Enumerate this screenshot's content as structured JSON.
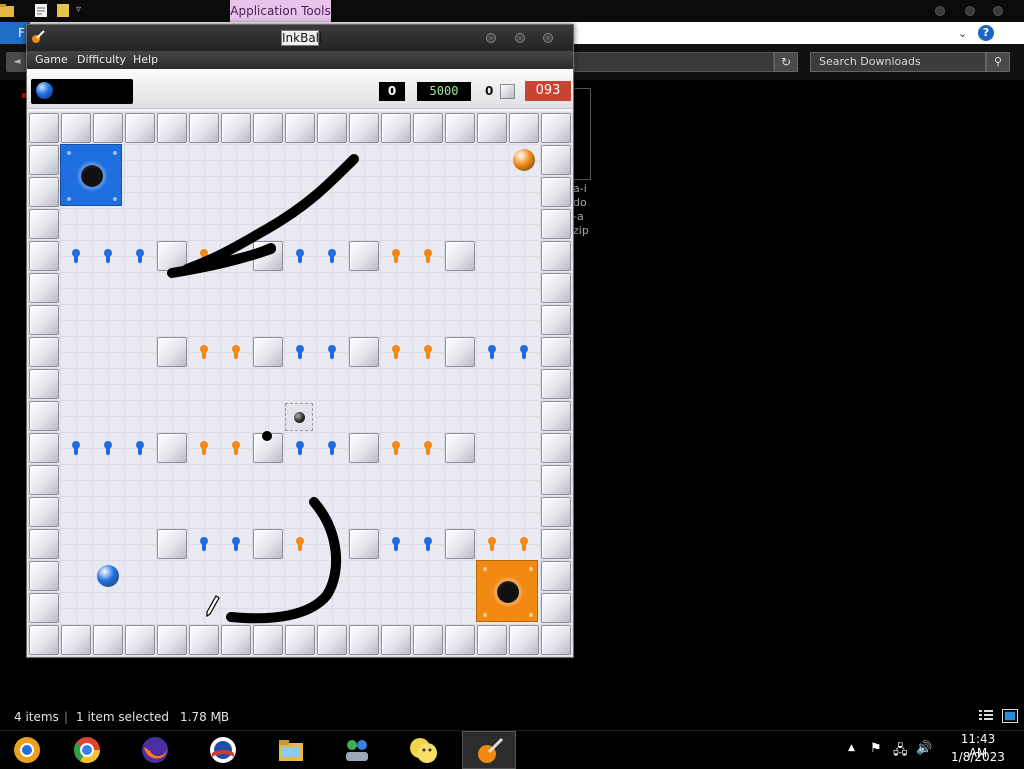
{
  "explorer": {
    "context_tab": "Application Tools",
    "file_tab": "F",
    "search_placeholder": "Search Downloads",
    "back_glyph": "◄",
    "refresh_glyph": "↻",
    "search_glyph": "⚲",
    "help_glyph": "?",
    "chevron_glyph": "⌄",
    "file_label": "a-i\ndo\n-a\nzip",
    "status": {
      "items": "4 items",
      "separator": "|",
      "selected": "1 item selected",
      "size": "1.78 MB"
    }
  },
  "inkball": {
    "title": "InkBall",
    "menu": [
      "Game",
      "Difficulty",
      "Help"
    ],
    "score": {
      "ball_count": "0",
      "points": "5000",
      "balls_missed": "0",
      "timer": "093"
    },
    "colors": {
      "blue": "#1f6ee0",
      "orange": "#f28a12",
      "timer_bg": "#c84331",
      "points_text": "#9ee79e"
    },
    "board": {
      "note": "17x17 grid of cells; walls, holes, keyholes, balls and ink strokes",
      "walls": [
        [
          0,
          0
        ],
        [
          1,
          0
        ],
        [
          2,
          0
        ],
        [
          3,
          0
        ],
        [
          4,
          0
        ],
        [
          5,
          0
        ],
        [
          6,
          0
        ],
        [
          7,
          0
        ],
        [
          8,
          0
        ],
        [
          9,
          0
        ],
        [
          10,
          0
        ],
        [
          11,
          0
        ],
        [
          12,
          0
        ],
        [
          13,
          0
        ],
        [
          14,
          0
        ],
        [
          15,
          0
        ],
        [
          16,
          0
        ],
        [
          0,
          16
        ],
        [
          1,
          16
        ],
        [
          2,
          16
        ],
        [
          3,
          16
        ],
        [
          4,
          16
        ],
        [
          5,
          16
        ],
        [
          6,
          16
        ],
        [
          7,
          16
        ],
        [
          8,
          16
        ],
        [
          9,
          16
        ],
        [
          10,
          16
        ],
        [
          11,
          16
        ],
        [
          12,
          16
        ],
        [
          13,
          16
        ],
        [
          14,
          16
        ],
        [
          15,
          16
        ],
        [
          16,
          16
        ],
        [
          0,
          1
        ],
        [
          0,
          2
        ],
        [
          0,
          3
        ],
        [
          0,
          4
        ],
        [
          0,
          5
        ],
        [
          0,
          6
        ],
        [
          0,
          7
        ],
        [
          0,
          8
        ],
        [
          0,
          9
        ],
        [
          0,
          10
        ],
        [
          0,
          11
        ],
        [
          0,
          12
        ],
        [
          0,
          13
        ],
        [
          0,
          14
        ],
        [
          0,
          15
        ],
        [
          16,
          1
        ],
        [
          16,
          2
        ],
        [
          16,
          3
        ],
        [
          16,
          4
        ],
        [
          16,
          5
        ],
        [
          16,
          6
        ],
        [
          16,
          7
        ],
        [
          16,
          8
        ],
        [
          16,
          9
        ],
        [
          16,
          10
        ],
        [
          16,
          11
        ],
        [
          16,
          12
        ],
        [
          16,
          13
        ],
        [
          16,
          14
        ],
        [
          16,
          15
        ],
        [
          4,
          4
        ],
        [
          7,
          4
        ],
        [
          10,
          4
        ],
        [
          13,
          4
        ],
        [
          4,
          7
        ],
        [
          7,
          7
        ],
        [
          10,
          7
        ],
        [
          13,
          7
        ],
        [
          4,
          10
        ],
        [
          7,
          10
        ],
        [
          10,
          10
        ],
        [
          13,
          10
        ],
        [
          4,
          13
        ],
        [
          7,
          13
        ],
        [
          10,
          13
        ],
        [
          13,
          13
        ]
      ],
      "keyholes": [
        {
          "c": 1,
          "r": 4,
          "color": "blue"
        },
        {
          "c": 2,
          "r": 4,
          "color": "blue"
        },
        {
          "c": 3,
          "r": 4,
          "color": "blue"
        },
        {
          "c": 5,
          "r": 4,
          "color": "orange"
        },
        {
          "c": 8,
          "r": 4,
          "color": "blue"
        },
        {
          "c": 9,
          "r": 4,
          "color": "blue"
        },
        {
          "c": 11,
          "r": 4,
          "color": "orange"
        },
        {
          "c": 12,
          "r": 4,
          "color": "orange"
        },
        {
          "c": 5,
          "r": 7,
          "color": "orange"
        },
        {
          "c": 6,
          "r": 7,
          "color": "orange"
        },
        {
          "c": 8,
          "r": 7,
          "color": "blue"
        },
        {
          "c": 9,
          "r": 7,
          "color": "blue"
        },
        {
          "c": 11,
          "r": 7,
          "color": "orange"
        },
        {
          "c": 12,
          "r": 7,
          "color": "orange"
        },
        {
          "c": 14,
          "r": 7,
          "color": "blue"
        },
        {
          "c": 15,
          "r": 7,
          "color": "blue"
        },
        {
          "c": 1,
          "r": 10,
          "color": "blue"
        },
        {
          "c": 2,
          "r": 10,
          "color": "blue"
        },
        {
          "c": 3,
          "r": 10,
          "color": "blue"
        },
        {
          "c": 5,
          "r": 10,
          "color": "orange"
        },
        {
          "c": 6,
          "r": 10,
          "color": "orange"
        },
        {
          "c": 8,
          "r": 10,
          "color": "blue"
        },
        {
          "c": 9,
          "r": 10,
          "color": "blue"
        },
        {
          "c": 11,
          "r": 10,
          "color": "orange"
        },
        {
          "c": 12,
          "r": 10,
          "color": "orange"
        },
        {
          "c": 5,
          "r": 13,
          "color": "blue"
        },
        {
          "c": 6,
          "r": 13,
          "color": "blue"
        },
        {
          "c": 8,
          "r": 13,
          "color": "orange"
        },
        {
          "c": 11,
          "r": 13,
          "color": "blue"
        },
        {
          "c": 12,
          "r": 13,
          "color": "blue"
        },
        {
          "c": 14,
          "r": 13,
          "color": "orange"
        },
        {
          "c": 15,
          "r": 13,
          "color": "orange"
        }
      ],
      "holes": [
        {
          "c": 1,
          "r": 1,
          "color": "blue"
        },
        {
          "c": 14,
          "r": 14,
          "color": "orange"
        }
      ],
      "balls": [
        {
          "c": 15,
          "r": 1,
          "color": "orange"
        },
        {
          "c": 2,
          "r": 14,
          "color": "blue"
        }
      ]
    }
  },
  "taskbar": {
    "apps": [
      "chrome-canary",
      "chrome",
      "firefox",
      "obama-logo",
      "file-explorer",
      "network-people",
      "smiley-app",
      "inkball"
    ],
    "clock_time": "11:43 AM",
    "clock_date": "1/8/2023",
    "tray_up": "▲",
    "tray_flag": "⚑",
    "tray_network": "🖧",
    "tray_volume": "🔊"
  }
}
